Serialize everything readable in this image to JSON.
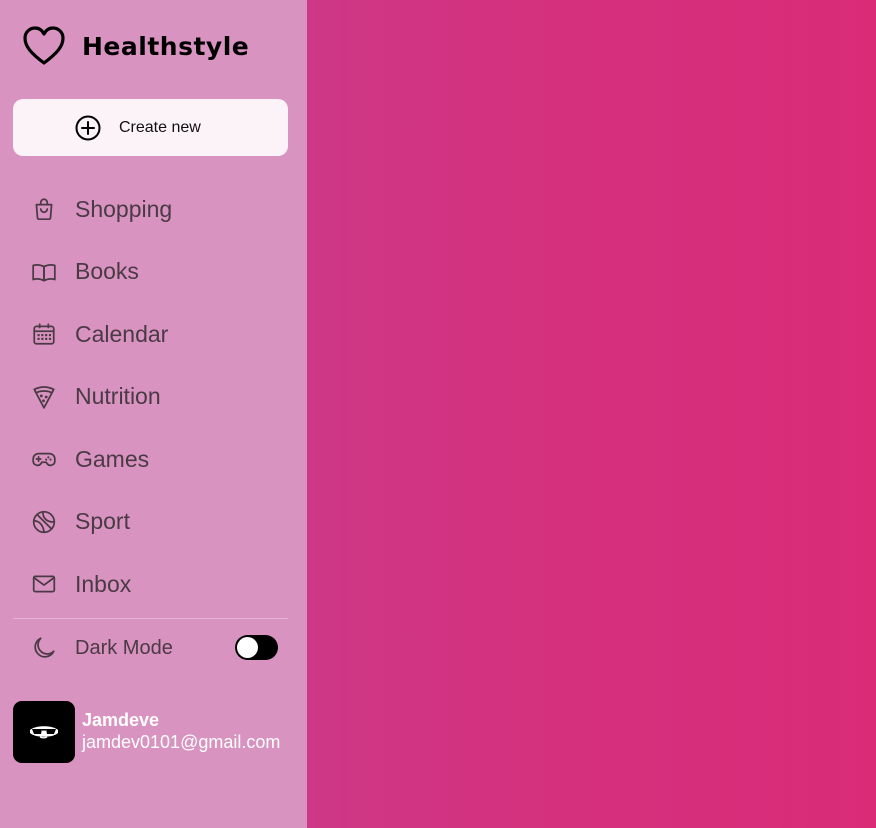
{
  "brand": {
    "title": "Healthstyle",
    "icon": "heart-icon"
  },
  "create": {
    "label": "Create new",
    "icon": "plus-circle-icon"
  },
  "nav": {
    "items": [
      {
        "label": "Shopping",
        "icon": "shopping-bag-icon"
      },
      {
        "label": "Books",
        "icon": "book-icon"
      },
      {
        "label": "Calendar",
        "icon": "calendar-icon"
      },
      {
        "label": "Nutrition",
        "icon": "pizza-icon"
      },
      {
        "label": "Games",
        "icon": "gamepad-icon"
      },
      {
        "label": "Sport",
        "icon": "ball-icon"
      },
      {
        "label": "Inbox",
        "icon": "mail-icon"
      }
    ]
  },
  "settings": {
    "dark_mode_label": "Dark Mode",
    "dark_mode_icon": "moon-icon",
    "dark_mode_on": false
  },
  "user": {
    "name": "Jamdeve",
    "email": "jamdev0101@gmail.com",
    "avatar_icon": "avatar-sunglasses-icon"
  },
  "colors": {
    "sidebar_bg": "#d993c0",
    "main_gradient_start": "#c4418f",
    "main_gradient_end": "#da2b77",
    "button_bg": "#fcf3f9",
    "nav_text": "#4a3a45"
  }
}
